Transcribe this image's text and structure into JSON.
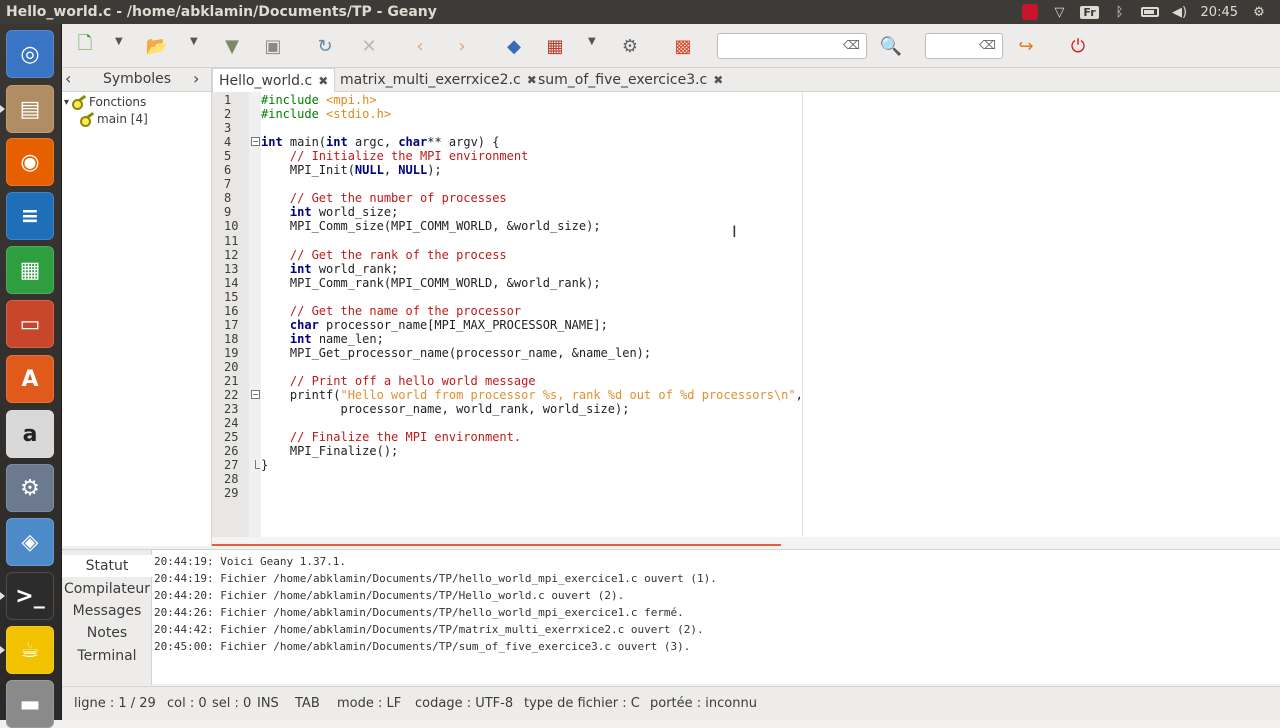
{
  "window": {
    "title": "Hello_world.c - /home/abklamin/Documents/TP - Geany"
  },
  "tray": {
    "keyboard": "Fr",
    "clock": "20:45"
  },
  "launcher": [
    {
      "name": "ubuntu-dash",
      "glyph": "◎",
      "color": "#3a74c4"
    },
    {
      "name": "files",
      "glyph": "▤",
      "color": "#b08d63"
    },
    {
      "name": "firefox",
      "glyph": "◉",
      "color": "#e66000"
    },
    {
      "name": "writer",
      "glyph": "≡",
      "color": "#1e6fb8"
    },
    {
      "name": "calc",
      "glyph": "▦",
      "color": "#2e9e3e"
    },
    {
      "name": "impress",
      "glyph": "▭",
      "color": "#c8472a"
    },
    {
      "name": "software",
      "glyph": "A",
      "color": "#e05b1b"
    },
    {
      "name": "amazon",
      "glyph": "a",
      "color": "#d8d8d8"
    },
    {
      "name": "settings",
      "glyph": "⚙",
      "color": "#6b7a8f"
    },
    {
      "name": "system-monitor",
      "glyph": "◈",
      "color": "#4d8bc8"
    },
    {
      "name": "terminal",
      "glyph": ">_",
      "color": "#2c2c2c"
    },
    {
      "name": "geany",
      "glyph": "☕",
      "color": "#f2c200"
    },
    {
      "name": "drive",
      "glyph": "▬",
      "color": "#8a8a8a"
    }
  ],
  "symbols": {
    "tab_label": "Symboles",
    "tree": [
      {
        "label": "Fonctions",
        "indent": 0
      },
      {
        "label": "main [4]",
        "indent": 1
      }
    ]
  },
  "tabs": [
    {
      "label": "Hello_world.c",
      "close": "✖",
      "active": true
    },
    {
      "label": "matrix_multi_exerrxice2.c",
      "close": "✖",
      "active": false
    },
    {
      "label": "sum_of_five_exercice3.c",
      "close": "✖",
      "active": false
    }
  ],
  "editor": {
    "line_count": 29,
    "lines": [
      [
        [
          "pp",
          "#include "
        ],
        [
          "inc",
          "<mpi.h>"
        ]
      ],
      [
        [
          "pp",
          "#include "
        ],
        [
          "inc",
          "<stdio.h>"
        ]
      ],
      [],
      [
        [
          "kw",
          "int"
        ],
        [
          "kw2",
          " main("
        ],
        [
          "kw",
          "int"
        ],
        [
          "kw2",
          " argc, "
        ],
        [
          "kw",
          "char"
        ],
        [
          "kw2",
          "** argv) {"
        ]
      ],
      [
        [
          "kw2",
          "    "
        ],
        [
          "cm",
          "// Initialize the MPI environment"
        ]
      ],
      [
        [
          "kw2",
          "    MPI_Init("
        ],
        [
          "kw",
          "NULL"
        ],
        [
          "kw2",
          ", "
        ],
        [
          "kw",
          "NULL"
        ],
        [
          "kw2",
          ");"
        ]
      ],
      [],
      [
        [
          "kw2",
          "    "
        ],
        [
          "cm",
          "// Get the number of processes"
        ]
      ],
      [
        [
          "kw2",
          "    "
        ],
        [
          "kw",
          "int"
        ],
        [
          "kw2",
          " world_size;"
        ]
      ],
      [
        [
          "kw2",
          "    MPI_Comm_size(MPI_COMM_WORLD, &world_size);"
        ]
      ],
      [],
      [
        [
          "kw2",
          "    "
        ],
        [
          "cm",
          "// Get the rank of the process"
        ]
      ],
      [
        [
          "kw2",
          "    "
        ],
        [
          "kw",
          "int"
        ],
        [
          "kw2",
          " world_rank;"
        ]
      ],
      [
        [
          "kw2",
          "    MPI_Comm_rank(MPI_COMM_WORLD, &world_rank);"
        ]
      ],
      [],
      [
        [
          "kw2",
          "    "
        ],
        [
          "cm",
          "// Get the name of the processor"
        ]
      ],
      [
        [
          "kw2",
          "    "
        ],
        [
          "kw",
          "char"
        ],
        [
          "kw2",
          " processor_name[MPI_MAX_PROCESSOR_NAME];"
        ]
      ],
      [
        [
          "kw2",
          "    "
        ],
        [
          "kw",
          "int"
        ],
        [
          "kw2",
          " name_len;"
        ]
      ],
      [
        [
          "kw2",
          "    MPI_Get_processor_name(processor_name, &name_len);"
        ]
      ],
      [],
      [
        [
          "kw2",
          "    "
        ],
        [
          "cm",
          "// Print off a hello world message"
        ]
      ],
      [
        [
          "kw2",
          "    printf("
        ],
        [
          "st",
          "\"Hello world from processor %s, rank %d out of %d processors\\n\""
        ],
        [
          "kw2",
          ","
        ]
      ],
      [
        [
          "kw2",
          "           processor_name, world_rank, world_size);"
        ]
      ],
      [],
      [
        [
          "kw2",
          "    "
        ],
        [
          "cm",
          "// Finalize the MPI environment."
        ]
      ],
      [
        [
          "kw2",
          "    MPI_Finalize();"
        ]
      ],
      [
        [
          "kw2",
          "}"
        ]
      ],
      [],
      []
    ],
    "fold_lines": [
      4,
      22,
      27
    ]
  },
  "messages": {
    "tabs": [
      "Statut",
      "Compilateur",
      "Messages",
      "Notes",
      "Terminal"
    ],
    "active_tab": 0,
    "log": [
      "20:44:19: Voici Geany 1.37.1.",
      "20:44:19: Fichier /home/abklamin/Documents/TP/hello_world_mpi_exercice1.c ouvert (1).",
      "20:44:20: Fichier /home/abklamin/Documents/TP/Hello_world.c ouvert (2).",
      "20:44:26: Fichier /home/abklamin/Documents/TP/hello_world_mpi_exercice1.c fermé.",
      "20:44:42: Fichier /home/abklamin/Documents/TP/matrix_multi_exerrxice2.c ouvert (2).",
      "20:45:00: Fichier /home/abklamin/Documents/TP/sum_of_five_exercice3.c ouvert (3)."
    ]
  },
  "status": {
    "line": "ligne : 1 / 29",
    "col": "col : 0",
    "sel": "sel : 0",
    "ins": "INS",
    "tab": "TAB",
    "mode": "mode : LF",
    "encoding": "codage : UTF-8",
    "filetype": "type de fichier : C",
    "scope": "portée : inconnu"
  }
}
